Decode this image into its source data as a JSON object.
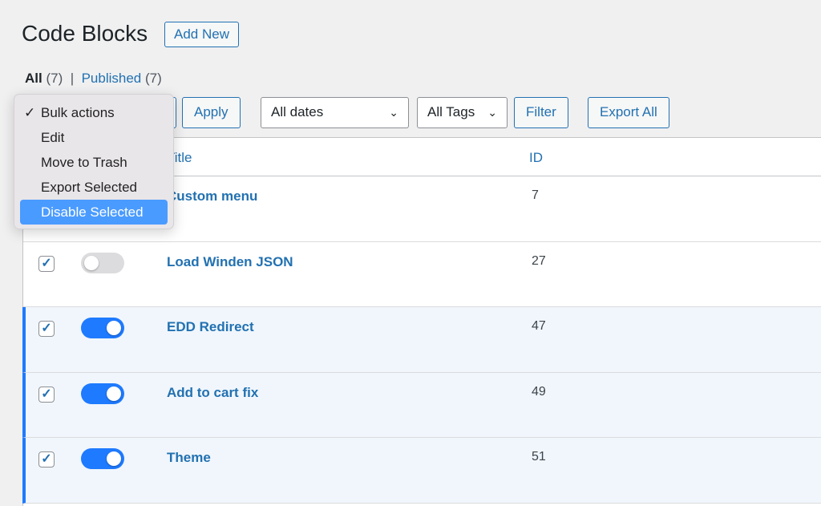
{
  "page": {
    "title": "Code Blocks",
    "add_new": "Add New"
  },
  "filters": {
    "all_label": "All",
    "all_count": "(7)",
    "sep": "|",
    "published_label": "Published",
    "published_count": "(7)"
  },
  "toolbar": {
    "apply": "Apply",
    "dates": "All dates",
    "tags": "All Tags",
    "filter": "Filter",
    "export_all": "Export All"
  },
  "table": {
    "col_title": "Title",
    "col_id": "ID",
    "rows": [
      {
        "title": "Custom menu",
        "id": "7",
        "checked": false,
        "enabled": false
      },
      {
        "title": "Load Winden JSON",
        "id": "27",
        "checked": true,
        "enabled": false
      },
      {
        "title": "EDD Redirect",
        "id": "47",
        "checked": true,
        "enabled": true
      },
      {
        "title": "Add to cart fix",
        "id": "49",
        "checked": true,
        "enabled": true
      },
      {
        "title": "Theme",
        "id": "51",
        "checked": true,
        "enabled": true
      }
    ]
  },
  "bulk_menu": {
    "items": [
      "Bulk actions",
      "Edit",
      "Move to Trash",
      "Export Selected",
      "Disable Selected"
    ],
    "selected": "Bulk actions",
    "highlighted": "Disable Selected",
    "check": "✓"
  },
  "colors": {
    "accent": "#2271b1",
    "toggle_on": "#1e7aff",
    "row_active_bg": "#f0f6fc"
  }
}
